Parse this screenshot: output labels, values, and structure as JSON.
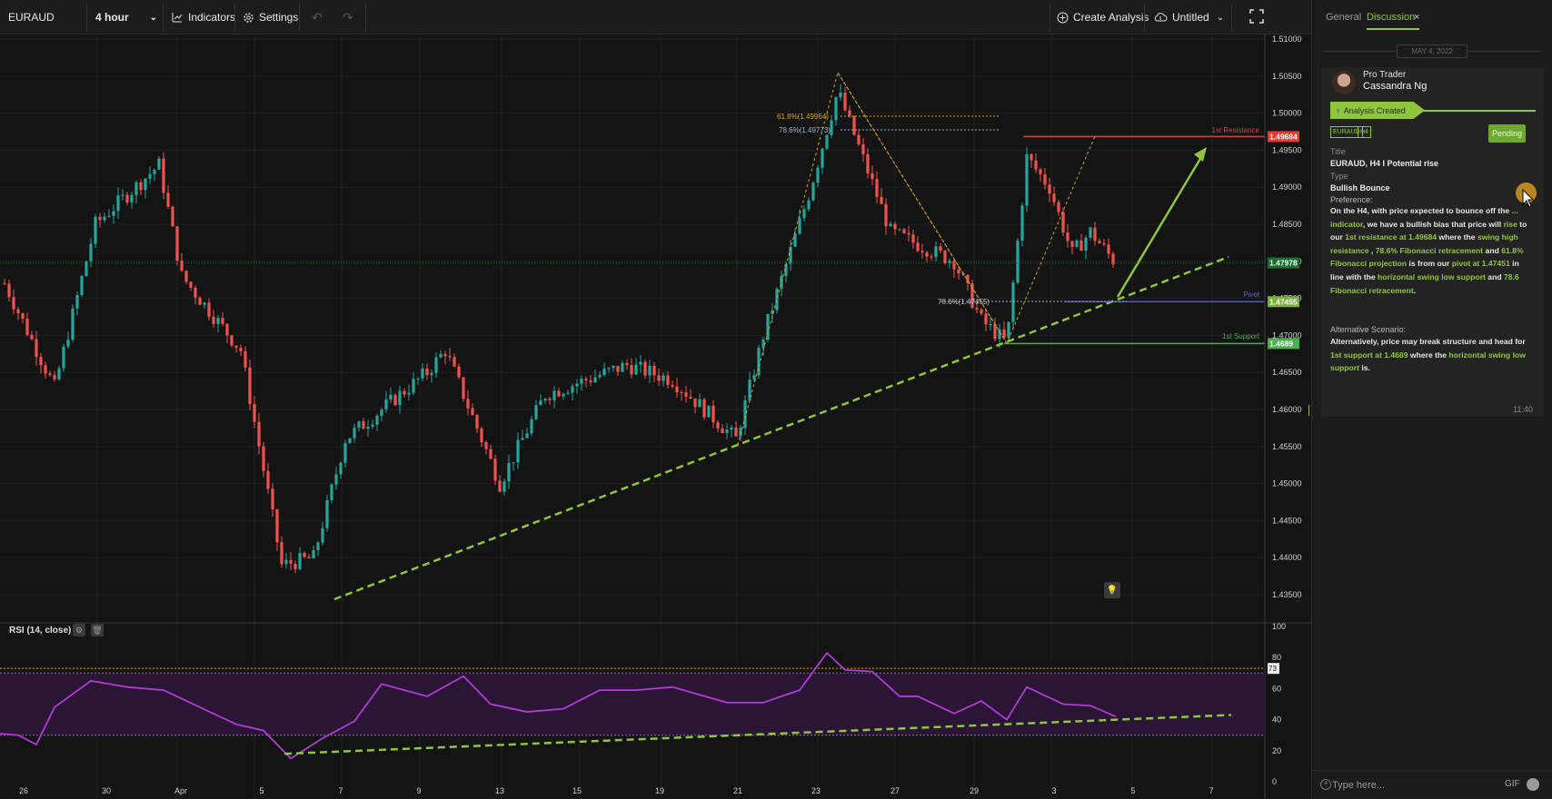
{
  "toolbar": {
    "symbol": "EURAUD",
    "interval": "4 hour",
    "indicators": "Indicators",
    "settings": "Settings",
    "undo": "↶",
    "redo": "↷",
    "create_analysis": "Create Analysis",
    "layout": "Untitled"
  },
  "chart": {
    "price_axis": [
      "1.51000",
      "1.50500",
      "1.50000",
      "1.49500",
      "1.49000",
      "1.48500",
      "1.48000",
      "1.47500",
      "1.47000",
      "1.46500",
      "1.46000",
      "1.45500",
      "1.45000",
      "1.44500",
      "1.44000",
      "1.43500"
    ],
    "time_axis": [
      "26",
      "30",
      "Apr",
      "5",
      "7",
      "9",
      "13",
      "15",
      "19",
      "21",
      "23",
      "27",
      "29",
      "3",
      "5",
      "7"
    ],
    "resistance_price": "1.49684",
    "resistance_label": "1st Resistance",
    "last_price": "1.47978",
    "pivot_price": "1.47455",
    "pivot_label": "Pivot",
    "support_price": "1.4689",
    "support_label": "1st Support",
    "fib_1": "61.8%(1.49964)",
    "fib_2": "78.6%(1.49773)",
    "fib_3": "78.6%(1.47455)",
    "colors": {
      "up": "#26a69a",
      "down": "#ef5350",
      "trend": "#8fc640",
      "resistance": "#e53935",
      "support": "#4caf50",
      "pivot": "#5c6bc0"
    }
  },
  "rsi": {
    "label": "RSI (14, close)",
    "axis": [
      "100",
      "80",
      "60",
      "40",
      "20",
      "0"
    ],
    "value_badge": "73",
    "line_color": "#b23bd4"
  },
  "panel": {
    "tab_general": "General",
    "tab_discussion": "Discussion",
    "date": "MAY 4, 2022",
    "author_role": "Pro Trader",
    "author_name": "Cassandra Ng",
    "status_banner": "Analysis Created",
    "tag_symbol": "EURAUD",
    "tag_tf": "H4",
    "pending": "Pending",
    "title_label": "Title",
    "title_value": "EURAUD, H4 I Potential rise",
    "type_label": "Type",
    "type_value": "Bullish Bounce",
    "preference_label": "Preference:",
    "pref": {
      "t1": "On the H4, with price expected to bounce off the ",
      "g1": "...",
      "g2": "indicator",
      "t2": ", we have a bullish bias that price will ",
      "g3": "rise",
      "t3": " to our ",
      "g4": "1st resistance at 1.49684",
      "t4": " where the ",
      "g5": "swing high resistance",
      "t5": " , ",
      "g6": "78.6% Fibonacci retracement",
      "t6": " and ",
      "g7": "61.8% Fibonacci projection",
      "t7": " is from our ",
      "g8": "pivot at 1.47451",
      "t8": " in line with the ",
      "g9": "horizontal swing low support",
      "t9": " and ",
      "g10": "78.6 Fibonacci retracement",
      "t10": "."
    },
    "alt_label": "Alternative Scenario:",
    "alt": {
      "t1": "Alternatively, price may break structure and head for ",
      "g1": "1st support at 1.4689",
      "t2": " where the ",
      "g2": "horizontal swing low support",
      "t3": " is."
    },
    "time": "11:40",
    "input_placeholder": "Type here...",
    "gif": "GIF"
  }
}
